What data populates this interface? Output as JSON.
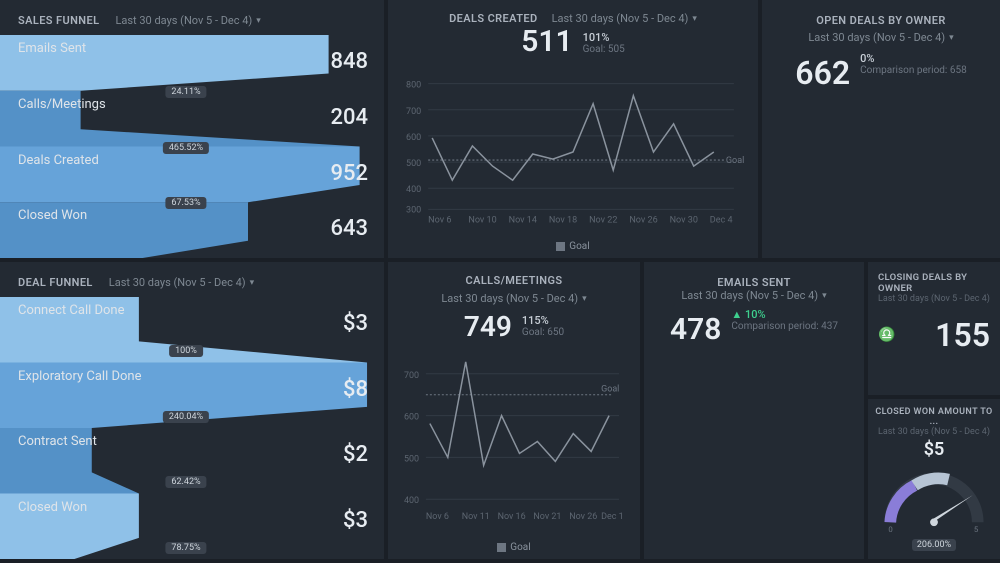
{
  "period_label": "Last 30 days (Nov 5 - Dec 4)",
  "sales_funnel": {
    "title": "SALES FUNNEL",
    "stages": [
      {
        "label": "Emails Sent",
        "value": "848",
        "pct": null
      },
      {
        "label": "Calls/Meetings",
        "value": "204",
        "pct": "24.11%"
      },
      {
        "label": "Deals Created",
        "value": "952",
        "pct": "465.52%"
      },
      {
        "label": "Closed Won",
        "value": "643",
        "pct": "67.53%"
      }
    ]
  },
  "deals_created": {
    "title": "DEALS CREATED",
    "value": "511",
    "pct": "101%",
    "goal_label": "Goal: 505",
    "legend_label": "Goal"
  },
  "open_deals": {
    "title": "OPEN DEALS BY OWNER",
    "value": "662",
    "pct": "0%",
    "comparison": "Comparison period: 658"
  },
  "deal_funnel": {
    "title": "DEAL FUNNEL",
    "stages": [
      {
        "label": "Connect Call Done",
        "value": "$3",
        "pct": "100%"
      },
      {
        "label": "Exploratory Call Done",
        "value": "$8",
        "pct": "240.04%"
      },
      {
        "label": "Contract Sent",
        "value": "$2",
        "pct": "62.42%"
      },
      {
        "label": "Closed Won",
        "value": "$3",
        "pct": "78.75%"
      }
    ]
  },
  "calls_meetings": {
    "title": "CALLS/MEETINGS",
    "value": "749",
    "pct": "115%",
    "goal_label": "Goal: 650",
    "legend_label": "Goal"
  },
  "emails_sent": {
    "title": "EMAILS SENT",
    "value": "478",
    "growth": "▲ 10%",
    "comparison": "Comparison period: 437"
  },
  "closing_deals": {
    "title": "CLOSING DEALS BY OWNER",
    "period": "Last 30 days (Nov 5 - Dec 4)",
    "value": "155"
  },
  "closed_won_amount": {
    "title": "CLOSED WON AMOUNT TO ...",
    "period": "Last 30 days (Nov 5 - Dec 4)",
    "value": "$5",
    "gauge_pct": "206.00%"
  },
  "chart_data": [
    {
      "type": "bar",
      "name": "sales_funnel",
      "categories": [
        "Emails Sent",
        "Calls/Meetings",
        "Deals Created",
        "Closed Won"
      ],
      "values": [
        848,
        204,
        952,
        643
      ]
    },
    {
      "type": "line",
      "name": "deals_created_chart",
      "x": [
        "Nov 6",
        "Nov 8",
        "Nov 10",
        "Nov 12",
        "Nov 14",
        "Nov 16",
        "Nov 18",
        "Nov 20",
        "Nov 22",
        "Nov 24",
        "Nov 26",
        "Nov 28",
        "Nov 30",
        "Dec 2",
        "Dec 4"
      ],
      "x_ticks": [
        "Nov 6",
        "Nov 10",
        "Nov 14",
        "Nov 18",
        "Nov 22",
        "Nov 26",
        "Nov 30",
        "Dec 4"
      ],
      "y_ticks": [
        300,
        400,
        500,
        600,
        700,
        800
      ],
      "values": [
        590,
        430,
        560,
        480,
        430,
        530,
        510,
        540,
        720,
        470,
        750,
        540,
        650,
        480,
        540
      ],
      "goal": 505,
      "goal_text": "Goal",
      "ylim": [
        300,
        800
      ],
      "ylabel": "",
      "xlabel": ""
    },
    {
      "type": "bar",
      "name": "deal_funnel",
      "categories": [
        "Connect Call Done",
        "Exploratory Call Done",
        "Contract Sent",
        "Closed Won"
      ],
      "values": [
        3,
        8,
        2,
        3
      ]
    },
    {
      "type": "line",
      "name": "calls_meetings_chart",
      "x": [
        "Nov 6",
        "Nov 8",
        "Nov 11",
        "Nov 13",
        "Nov 16",
        "Nov 18",
        "Nov 21",
        "Nov 23",
        "Nov 26",
        "Nov 28",
        "Dec 1"
      ],
      "x_ticks": [
        "Nov 6",
        "Nov 11",
        "Nov 16",
        "Nov 21",
        "Nov 26",
        "Dec 1"
      ],
      "y_ticks": [
        400,
        500,
        600,
        700
      ],
      "values": [
        580,
        500,
        740,
        480,
        600,
        510,
        540,
        490,
        560,
        520,
        600
      ],
      "goal": 650,
      "goal_text": "Goal",
      "ylim": [
        400,
        750
      ],
      "ylabel": "",
      "xlabel": ""
    },
    {
      "type": "area",
      "name": "closed_won_gauge",
      "value_pct": 206.0,
      "arc_start_deg": 180,
      "arc_end_deg": 0
    }
  ]
}
